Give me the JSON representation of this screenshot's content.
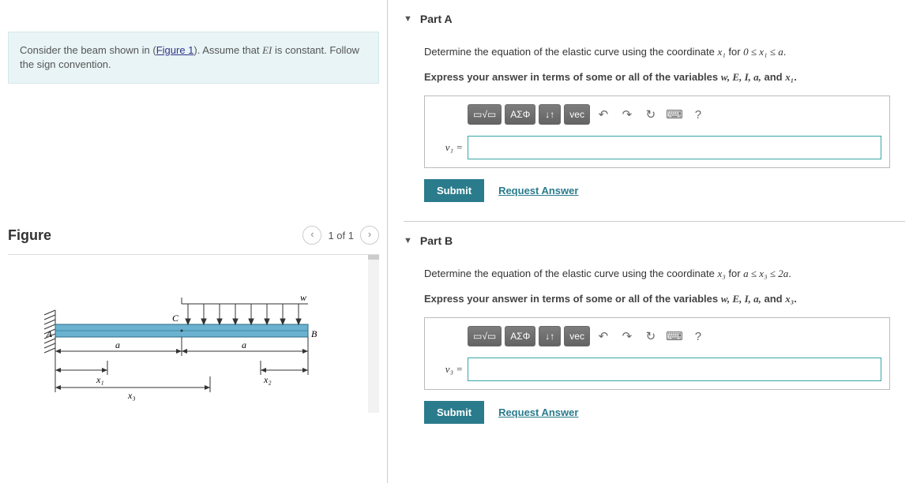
{
  "problem": {
    "text_before_link": "Consider the beam shown in (",
    "link_text": "Figure 1",
    "text_after_link": "). Assume that ",
    "ei_text": "EI",
    "text_after_ei": " is constant. Follow the sign convention."
  },
  "figure": {
    "title": "Figure",
    "pager": "1 of 1",
    "labels": {
      "w": "w",
      "A": "A",
      "B": "B",
      "C": "C",
      "a1": "a",
      "a2": "a",
      "x1": "x₁",
      "x2": "x₂",
      "x3": "x₃"
    }
  },
  "parts": [
    {
      "title": "Part A",
      "prompt_pre": "Determine the equation of the elastic curve using the coordinate ",
      "coord": "x₁",
      "prompt_mid": " for ",
      "range": "0 ≤ x₁ ≤ a",
      "prompt_end": ".",
      "express": "Express your answer in terms of some or all of the variables ",
      "vars": "w, E, I, a,",
      "express_and": " and ",
      "var_last": "x₁",
      "express_end": ".",
      "lhs": "v₁ = "
    },
    {
      "title": "Part B",
      "prompt_pre": "Determine the equation of the elastic curve using the coordinate ",
      "coord": "x₃",
      "prompt_mid": " for ",
      "range": "a ≤ x₃ ≤ 2a",
      "prompt_end": ".",
      "express": "Express your answer in terms of some or all of the variables ",
      "vars": "w, E, I, a,",
      "express_and": " and ",
      "var_last": "x₃",
      "express_end": ".",
      "lhs": "v₃ = "
    }
  ],
  "toolbar": {
    "templates": "▭√▭",
    "greek": "ΑΣΦ",
    "subsup": "↓↑",
    "vec": "vec",
    "undo": "↶",
    "redo": "↷",
    "reset": "↻",
    "keyboard": "⌨",
    "help": "?"
  },
  "buttons": {
    "submit": "Submit",
    "request": "Request Answer"
  }
}
